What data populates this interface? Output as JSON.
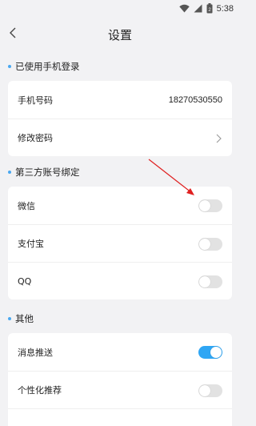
{
  "status_bar": {
    "time": "5:38",
    "battery_level": "2"
  },
  "header": {
    "title": "设置"
  },
  "sections": {
    "login": {
      "title": "已使用手机登录",
      "phone_label": "手机号码",
      "phone_value": "18270530550",
      "change_password_label": "修改密码"
    },
    "third_party": {
      "title": "第三方账号绑定",
      "wechat_label": "微信",
      "wechat_bound": false,
      "alipay_label": "支付宝",
      "alipay_bound": false,
      "qq_label": "QQ",
      "qq_bound": false
    },
    "other": {
      "title": "其他",
      "push_label": "消息推送",
      "push_enabled": true,
      "personalized_label": "个性化推荐",
      "personalized_enabled": false
    }
  },
  "colors": {
    "accent": "#2fa6f4",
    "annotation": "#e02020",
    "background": "#f2f2f4"
  }
}
